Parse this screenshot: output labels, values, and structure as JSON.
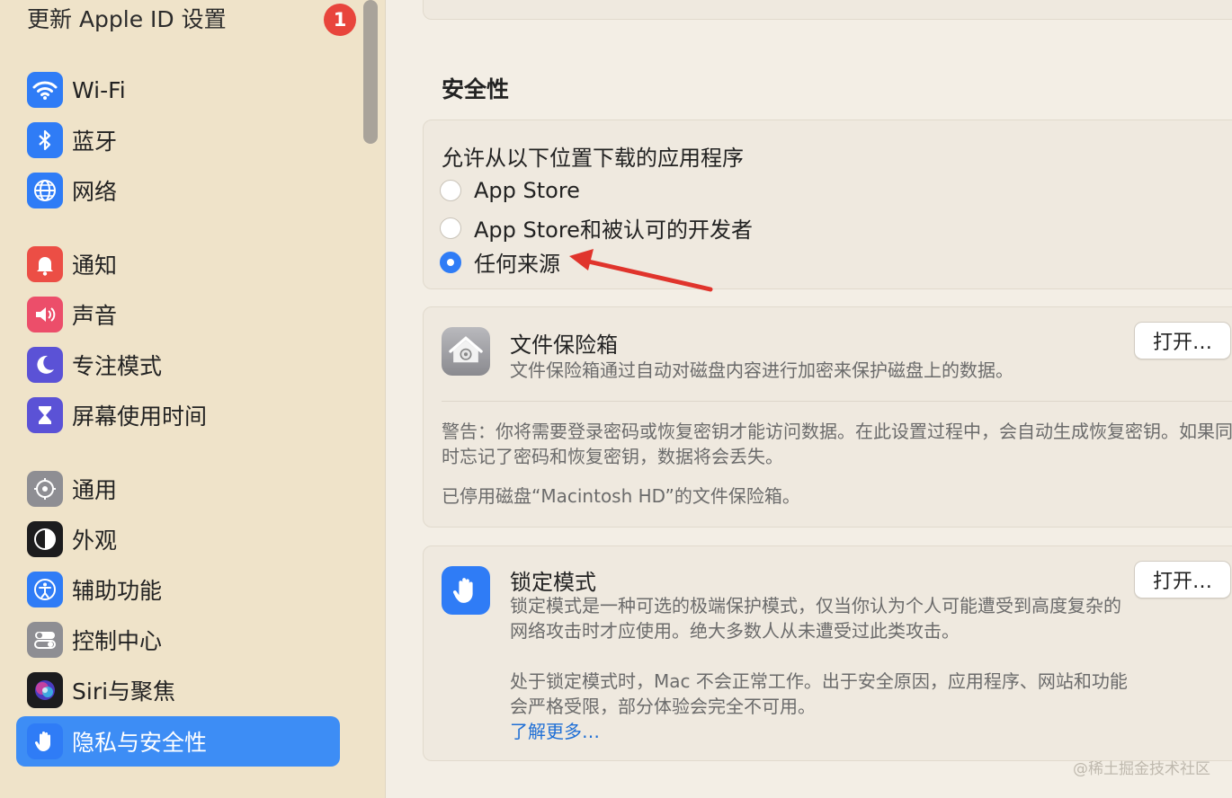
{
  "sidebar": {
    "update_label": "更新 Apple ID 设置",
    "update_badge": "1",
    "items": [
      {
        "label": "Wi-Fi",
        "icon": "wifi-icon",
        "color": "#2f7cf6"
      },
      {
        "label": "蓝牙",
        "icon": "bluetooth-icon",
        "color": "#2f7cf6"
      },
      {
        "label": "网络",
        "icon": "globe-icon",
        "color": "#2f7cf6"
      },
      {
        "label": "通知",
        "icon": "bell-icon",
        "color": "#ec4e45"
      },
      {
        "label": "声音",
        "icon": "speaker-icon",
        "color": "#ec4e6a"
      },
      {
        "label": "专注模式",
        "icon": "moon-icon",
        "color": "#5b52d6"
      },
      {
        "label": "屏幕使用时间",
        "icon": "hourglass-icon",
        "color": "#5b52d6"
      },
      {
        "label": "通用",
        "icon": "gear-icon",
        "color": "#8e8e93"
      },
      {
        "label": "外观",
        "icon": "appearance-icon",
        "color": "#1c1c1e"
      },
      {
        "label": "辅助功能",
        "icon": "accessibility-icon",
        "color": "#2f7cf6"
      },
      {
        "label": "控制中心",
        "icon": "toggles-icon",
        "color": "#8e8e93"
      },
      {
        "label": "Siri与聚焦",
        "icon": "siri-icon",
        "color": "#1c1c1e"
      },
      {
        "label": "隐私与安全性",
        "icon": "hand-icon",
        "color": "#2f7cf6",
        "active": true
      }
    ]
  },
  "security": {
    "title": "安全性",
    "allow_label": "允许从以下位置下载的应用程序",
    "options": [
      "App Store",
      "App Store和被认可的开发者",
      "任何来源"
    ],
    "selected": "任何来源"
  },
  "filevault": {
    "title": "文件保险箱",
    "desc": "文件保险箱通过自动对磁盘内容进行加密来保护磁盘上的数据。",
    "button": "打开…",
    "warning": "警告：你将需要登录密码或恢复密钥才能访问数据。在此设置过程中，会自动生成恢复密钥。如果同时忘记了密码和恢复密钥，数据将会丢失。",
    "status": "已停用磁盘“Macintosh HD”的文件保险箱。"
  },
  "lockdown": {
    "title": "锁定模式",
    "desc": "锁定模式是一种可选的极端保护模式，仅当你认为个人可能遭受到高度复杂的网络攻击时才应使用。绝大多数人从未遭受过此类攻击。",
    "desc2": "处于锁定模式时，Mac 不会正常工作。出于安全原因，应用程序、网站和功能会严格受限，部分体验会完全不可用。",
    "link": "了解更多…",
    "button": "打开…"
  },
  "watermark": "@稀土掘金技术社区",
  "accent": "#2f7cf6",
  "annotation_arrow_color": "#e0342c"
}
